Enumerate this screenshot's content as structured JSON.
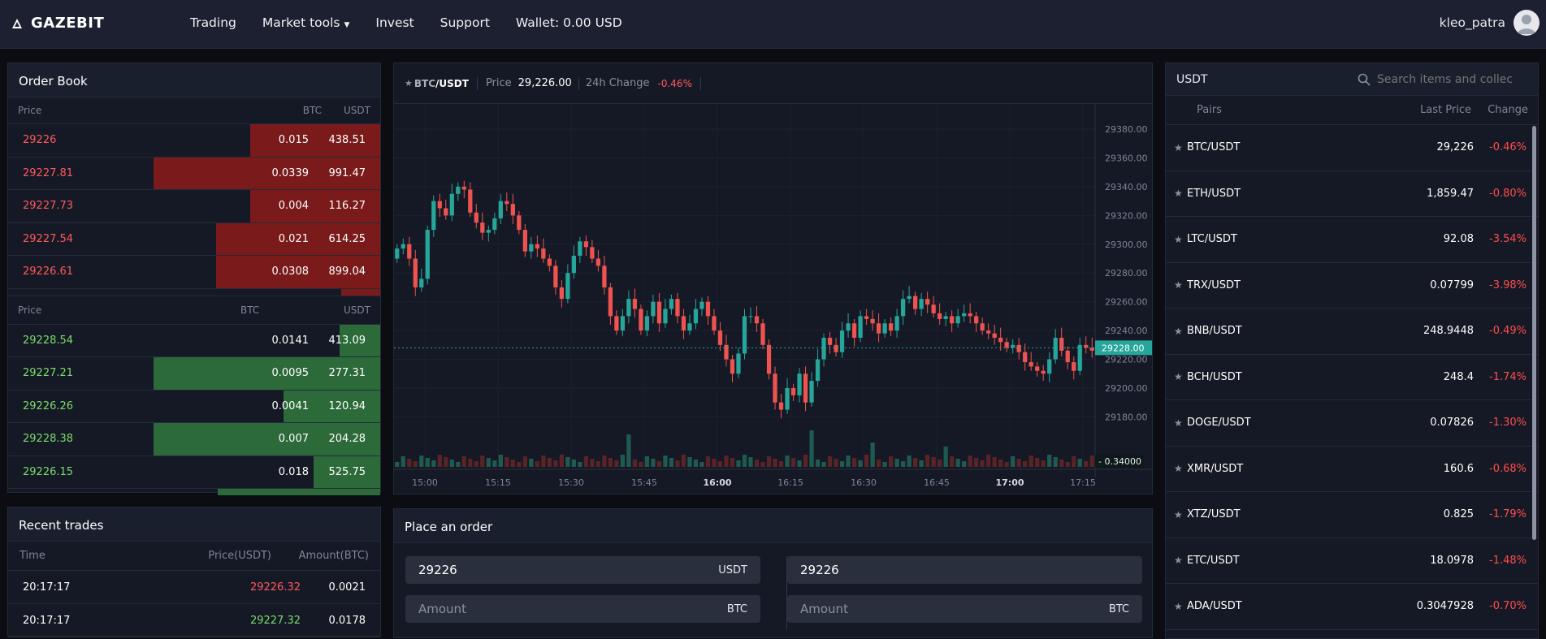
{
  "app": {
    "name": "GAZEBIT"
  },
  "nav": {
    "trading": "Trading",
    "market_tools": "Market tools",
    "invest": "Invest",
    "support": "Support",
    "wallet": "Wallet: 0.00 USD"
  },
  "user": {
    "name": "kleo_patra"
  },
  "order_book": {
    "title": "Order Book",
    "ask_headers": {
      "price": "Price",
      "btc": "BTC",
      "usdt": "USDT"
    },
    "asks": [
      {
        "price": "29226",
        "amount": "0.015",
        "total": "438.51",
        "depth": 0.35
      },
      {
        "price": "29227.81",
        "amount": "0.0339",
        "total": "991.47",
        "depth": 0.61
      },
      {
        "price": "29227.73",
        "amount": "0.004",
        "total": "116.27",
        "depth": 0.35
      },
      {
        "price": "29227.54",
        "amount": "0.021",
        "total": "614.25",
        "depth": 0.44
      },
      {
        "price": "29226.61",
        "amount": "0.0308",
        "total": "899.04",
        "depth": 0.44
      }
    ],
    "bid_headers": {
      "price": "Price",
      "btc": "BTC",
      "usdt": "USDT"
    },
    "bids": [
      {
        "price": "29228.54",
        "amount": "0.0141",
        "total": "413.09",
        "depth": 0.11
      },
      {
        "price": "29227.21",
        "amount": "0.0095",
        "total": "277.31",
        "depth": 0.61
      },
      {
        "price": "29226.26",
        "amount": "0.0041",
        "total": "120.94",
        "depth": 0.26
      },
      {
        "price": "29228.38",
        "amount": "0.007",
        "total": "204.28",
        "depth": 0.61
      },
      {
        "price": "29226.15",
        "amount": "0.018",
        "total": "525.75",
        "depth": 0.18
      }
    ]
  },
  "recent_trades": {
    "title": "Recent trades",
    "headers": {
      "time": "Time",
      "price": "Price(USDT)",
      "amount": "Amount(BTC)"
    },
    "rows": [
      {
        "time": "20:17:17",
        "price": "29226.32",
        "amount": "0.0021",
        "side": "sell"
      },
      {
        "time": "20:17:17",
        "price": "29227.32",
        "amount": "0.0178",
        "side": "buy"
      }
    ]
  },
  "chart_header": {
    "pair_base": "BTC",
    "pair_quote": "/USDT",
    "price_label": "Price",
    "price_value": "29,226.00",
    "change_label": "24h Change",
    "change_value": "-0.46%"
  },
  "chart_data": {
    "type": "candlestick",
    "y_ticks": [
      "29380.00",
      "29360.00",
      "29340.00",
      "29320.00",
      "29300.00",
      "29280.00",
      "29260.00",
      "29240.00",
      "29220.00",
      "29200.00",
      "29180.00"
    ],
    "ylim": [
      29165,
      29393
    ],
    "x_ticks": [
      "15:00",
      "15:15",
      "15:30",
      "15:45",
      "16:00",
      "16:15",
      "16:30",
      "16:45",
      "17:00",
      "17:15"
    ],
    "current_price": "29228.00",
    "volume_label": "0.34000",
    "colors": {
      "up": "#26a69a",
      "down": "#ef5350"
    }
  },
  "place_order": {
    "title": "Place an order",
    "buy": {
      "price_value": "29226",
      "price_unit": "USDT",
      "amount_placeholder": "Amount",
      "amount_unit": "BTC"
    },
    "sell": {
      "price_value": "29226",
      "amount_placeholder": "Amount",
      "amount_unit": "BTC"
    }
  },
  "markets": {
    "quote": "USDT",
    "search_placeholder": "Search items and collec",
    "headers": {
      "pairs": "Pairs",
      "last_price": "Last Price",
      "change": "Change"
    },
    "rows": [
      {
        "pair": "BTC/USDT",
        "last": "29,226",
        "change": "-0.46%"
      },
      {
        "pair": "ETH/USDT",
        "last": "1,859.47",
        "change": "-0.80%"
      },
      {
        "pair": "LTC/USDT",
        "last": "92.08",
        "change": "-3.54%"
      },
      {
        "pair": "TRX/USDT",
        "last": "0.07799",
        "change": "-3.98%"
      },
      {
        "pair": "BNB/USDT",
        "last": "248.9448",
        "change": "-0.49%"
      },
      {
        "pair": "BCH/USDT",
        "last": "248.4",
        "change": "-1.74%"
      },
      {
        "pair": "DOGE/USDT",
        "last": "0.07826",
        "change": "-1.30%"
      },
      {
        "pair": "XMR/USDT",
        "last": "160.6",
        "change": "-0.68%"
      },
      {
        "pair": "XTZ/USDT",
        "last": "0.825",
        "change": "-1.79%"
      },
      {
        "pair": "ETC/USDT",
        "last": "18.0978",
        "change": "-1.48%"
      },
      {
        "pair": "ADA/USDT",
        "last": "0.3047928",
        "change": "-0.70%"
      }
    ]
  }
}
